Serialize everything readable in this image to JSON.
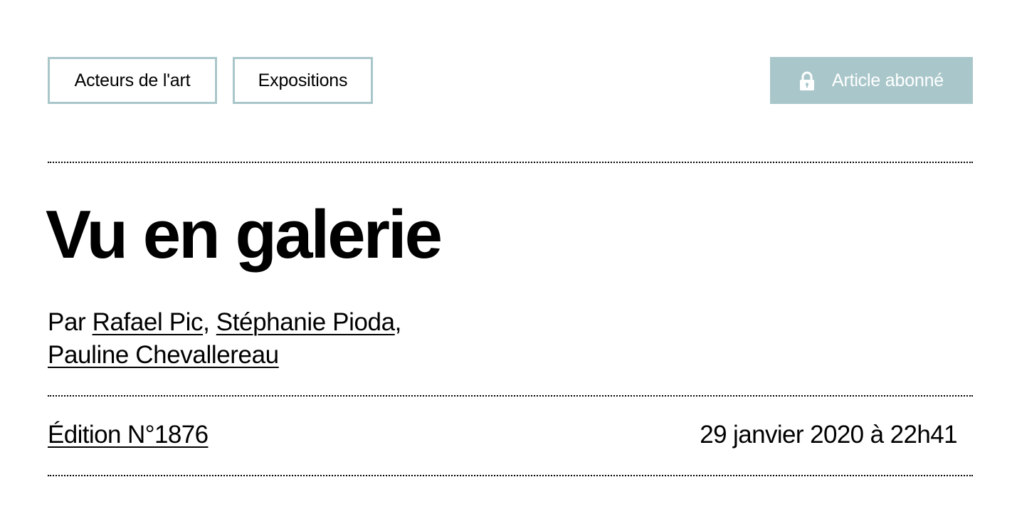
{
  "tags": [
    {
      "label": "Acteurs de l'art"
    },
    {
      "label": "Expositions"
    }
  ],
  "subscriber_badge": {
    "label": "Article abonné",
    "icon": "lock-icon",
    "color": "#a9c7ca"
  },
  "article": {
    "title": "Vu en galerie",
    "byline_prefix": "Par",
    "authors": [
      "Rafael Pic",
      "Stéphanie Pioda",
      "Pauline Chevallereau"
    ],
    "edition": "Édition N°1876",
    "date": "29 janvier 2020 à 22h41"
  },
  "colors": {
    "accent": "#a9c7ca",
    "text": "#000000",
    "background": "#ffffff"
  }
}
